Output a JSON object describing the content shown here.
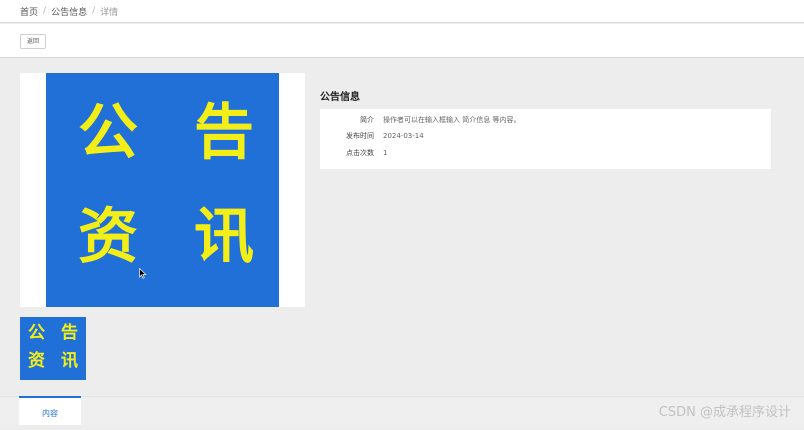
{
  "breadcrumb": {
    "home": "首页",
    "section": "公告信息",
    "current": "详情",
    "separator": "/"
  },
  "toolbar": {
    "back_label": "返回"
  },
  "poster": {
    "char1": "公",
    "char2": "告",
    "char3": "资",
    "char4": "讯",
    "background_color": "#2170d8",
    "text_color": "#f3ee18"
  },
  "detail": {
    "title": "公告信息",
    "rows": [
      {
        "label": "简介",
        "value": "操作者可以在输入框输入 简介信息 等内容。"
      },
      {
        "label": "发布时间",
        "value": "2024-03-14"
      },
      {
        "label": "点击次数",
        "value": "1"
      }
    ]
  },
  "tabs": {
    "content_label": "内容"
  },
  "watermark": "CSDN @成承程序设计"
}
